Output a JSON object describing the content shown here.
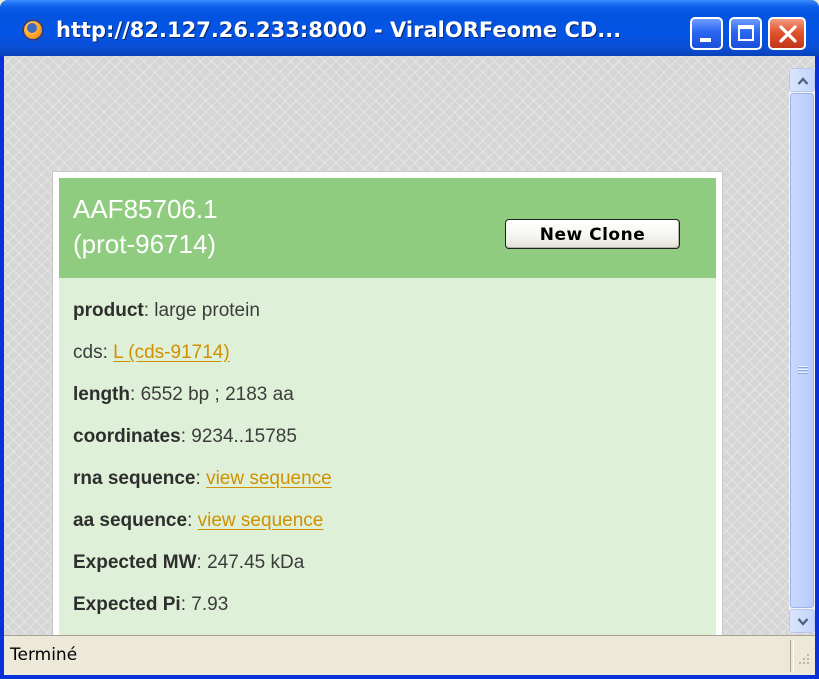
{
  "window": {
    "title": "http://82.127.26.233:8000 - ViralORFeome CD...",
    "icon": "firefox-icon"
  },
  "card": {
    "title": "AAF85706.1\n(prot-96714)",
    "new_clone_label": "New Clone",
    "fields": [
      {
        "label": "product",
        "sep": ": ",
        "value": "large protein"
      },
      {
        "label": "cds",
        "sep": ": ",
        "link": "L (cds-91714)"
      },
      {
        "label": "length",
        "sep": ": ",
        "value": "6552 bp ; 2183 aa"
      },
      {
        "label": "coordinates",
        "sep": ": ",
        "value": "9234..15785"
      },
      {
        "label": "rna sequence",
        "sep": ": ",
        "link": "view sequence"
      },
      {
        "label": "aa sequence",
        "sep": ": ",
        "link": "view sequence"
      },
      {
        "label": "Expected MW",
        "sep": ": ",
        "value": "247.45 kDa"
      },
      {
        "label": "Expected Pi",
        "sep": ": ",
        "value": "7.93"
      }
    ]
  },
  "status": {
    "text": "Terminé"
  },
  "colors": {
    "header_green": "#90cc80",
    "body_green": "#dff0d8",
    "link": "#d09000",
    "titlebar_blue": "#0454e6"
  }
}
